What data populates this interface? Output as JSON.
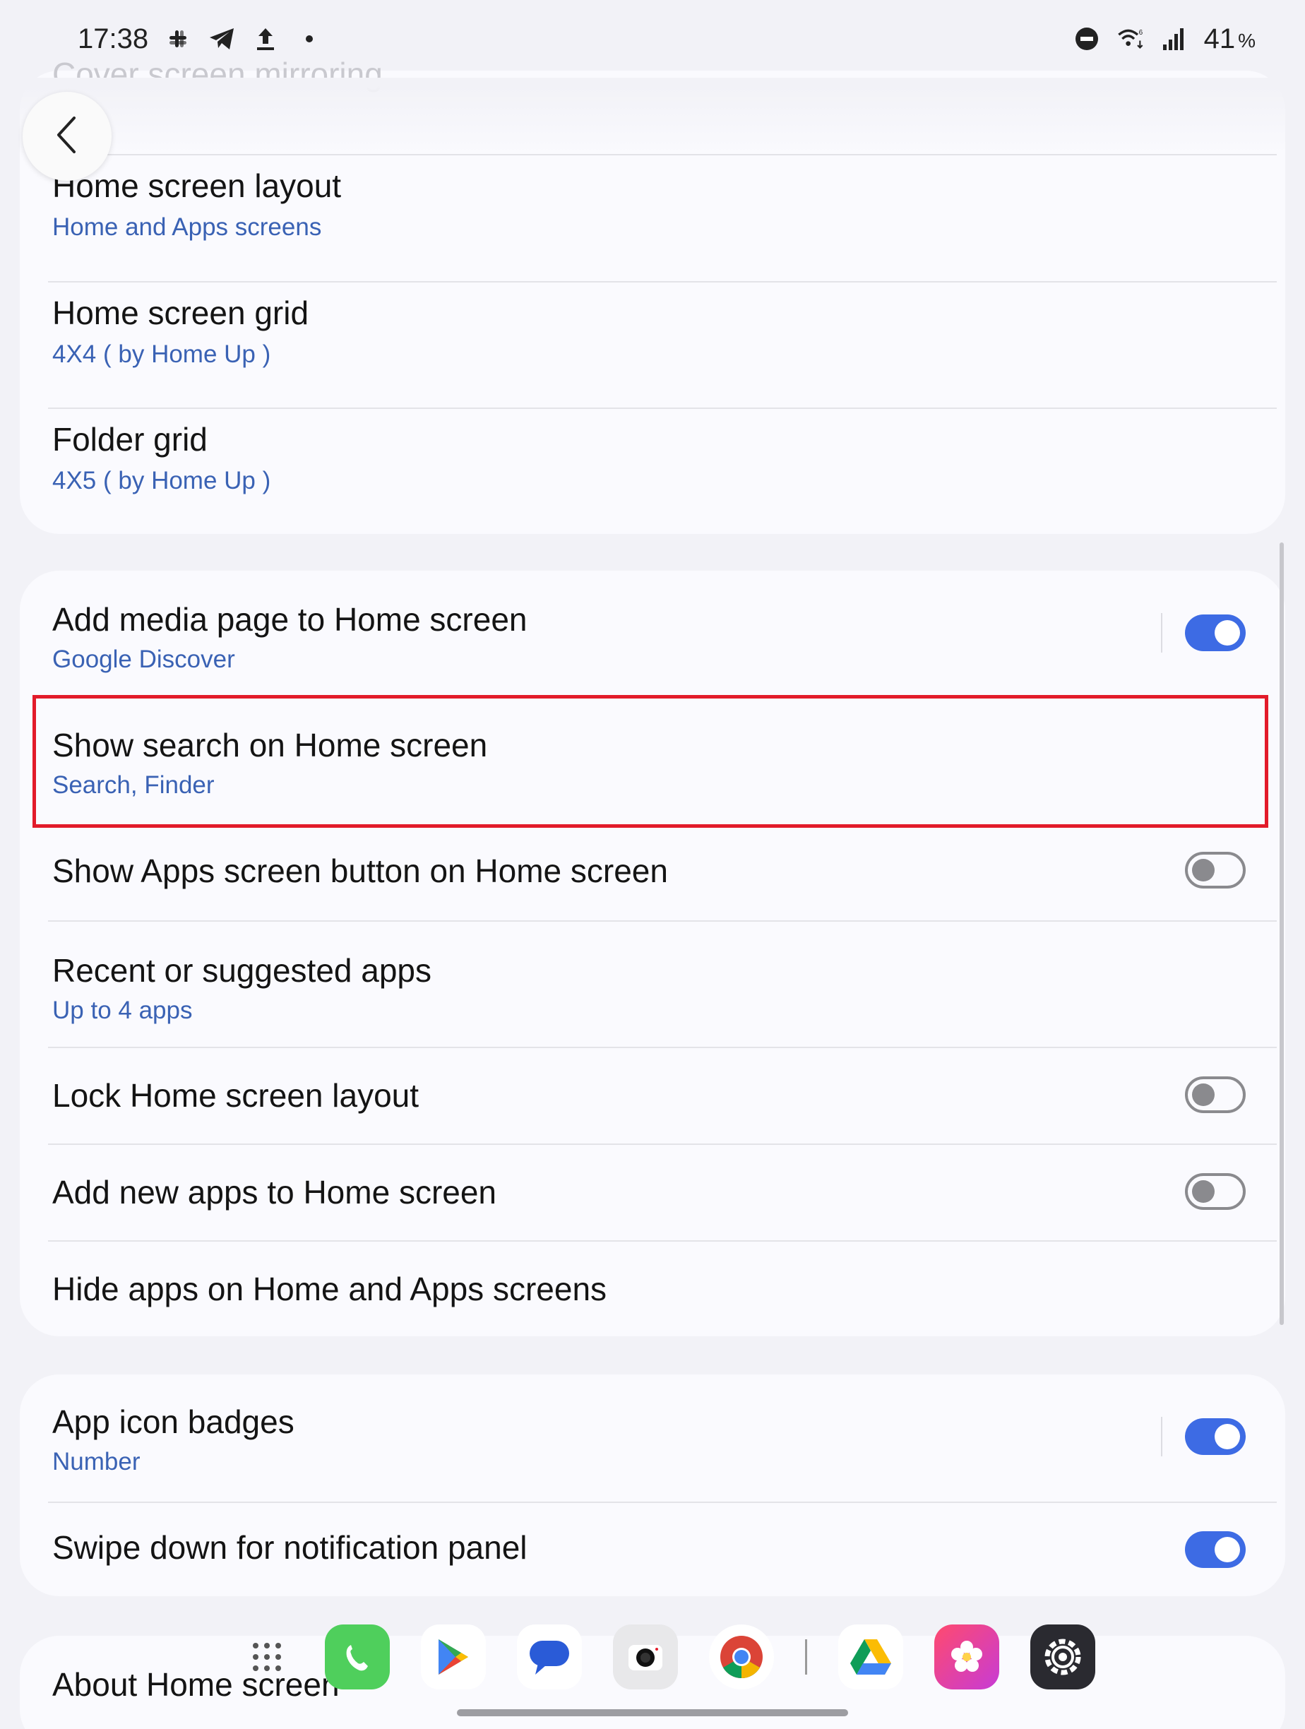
{
  "status_bar": {
    "time": "17:38",
    "battery": "41",
    "battery_unit": "%",
    "left_icons": [
      "slack-icon",
      "telegram-icon",
      "upload-icon",
      "dot-icon"
    ],
    "right_icons": [
      "do-not-disturb-icon",
      "wifi-6-icon",
      "signal-icon"
    ]
  },
  "header": {
    "ghost_title": "Cover screen mirroring"
  },
  "section1": {
    "rows": [
      {
        "title": "Home screen layout",
        "subtitle": "Home and Apps screens"
      },
      {
        "title": "Home screen grid",
        "subtitle": "4X4 ( by Home Up )"
      },
      {
        "title": "Folder grid",
        "subtitle": "4X5 ( by Home Up )"
      }
    ]
  },
  "section2": {
    "rows": [
      {
        "title": "Add media page to Home screen",
        "subtitle": "Google Discover",
        "toggle": "on"
      },
      {
        "title": "Show search on Home screen",
        "subtitle": "Search, Finder"
      },
      {
        "title": "Show Apps screen button on Home screen",
        "toggle": "off"
      },
      {
        "title": "Recent or suggested apps",
        "subtitle": "Up to 4 apps"
      },
      {
        "title": "Lock Home screen layout",
        "toggle": "off"
      },
      {
        "title": "Add new apps to Home screen",
        "toggle": "off"
      },
      {
        "title": "Hide apps on Home and Apps screens"
      }
    ]
  },
  "section3": {
    "rows": [
      {
        "title": "App icon badges",
        "subtitle": "Number",
        "toggle": "on"
      },
      {
        "title": "Swipe down for notification panel",
        "toggle": "on"
      }
    ]
  },
  "section4": {
    "rows": [
      {
        "title": "About Home screen"
      }
    ]
  },
  "dock": {
    "apps": [
      "app-drawer-icon",
      "phone-app-icon",
      "play-store-icon",
      "messages-app-icon",
      "camera-app-icon",
      "chrome-app-icon",
      "drive-app-icon",
      "gallery-app-icon",
      "settings-app-icon"
    ]
  },
  "colors": {
    "accent": "#3d6be4",
    "subtitle": "#3a62b4",
    "highlight": "#e21b2a",
    "background": "#f2f2f7",
    "card": "#fafafe"
  }
}
